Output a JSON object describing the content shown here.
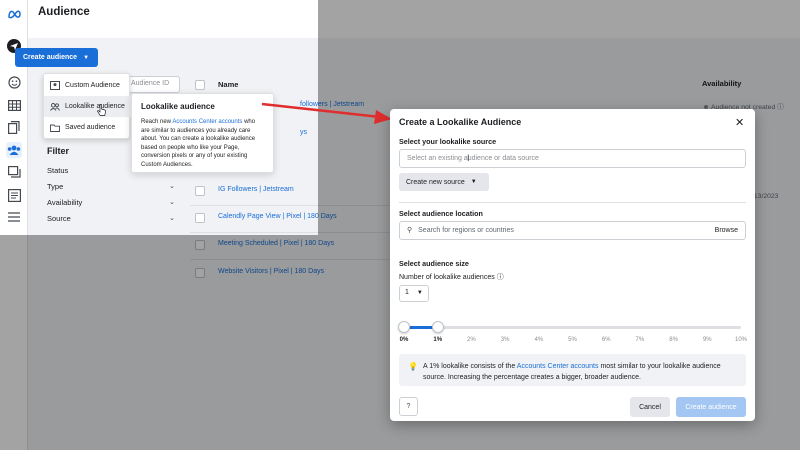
{
  "page": {
    "title": "Audience"
  },
  "toolbar": {
    "create_label": "Create audience",
    "audience_id_placeholder": "Audience ID"
  },
  "create_menu": {
    "items": [
      {
        "label": "Custom Audience",
        "icon": "people-icon"
      },
      {
        "label": "Lookalike audience",
        "icon": "people-outline-icon"
      },
      {
        "label": "Saved audience",
        "icon": "folder-icon"
      }
    ]
  },
  "tooltip": {
    "title": "Lookalike audience",
    "body_pre": "Reach new ",
    "body_link": "Accounts Center accounts",
    "body_post": " who are similar to audiences you already care about. You can create a lookalike audience based on people who like your Page, conversion pixels or any of your existing Custom Audiences."
  },
  "filter": {
    "title": "Filter",
    "items": [
      "Status",
      "Type",
      "Availability",
      "Source"
    ]
  },
  "table": {
    "name_header": "Name",
    "availability_header": "Availability",
    "rows": [
      {
        "name": "followers | Jetstream"
      },
      {
        "name": "ys"
      },
      {
        "name": "IG Followers | Jetstream"
      },
      {
        "name": "Calendly Page View | Pixel | 180 Days"
      },
      {
        "name": "Meeting Scheduled | Pixel | 180 Days"
      },
      {
        "name": "Website Visitors | Pixel | 180 Days"
      }
    ],
    "availability_status": "Audience not created",
    "date_fragment": "/13/2023"
  },
  "modal": {
    "title": "Create a Lookalike Audience",
    "source_label": "Select your lookalike source",
    "source_placeholder": "Select an existing audience or data source",
    "create_source_label": "Create new source",
    "location_label": "Select audience location",
    "location_placeholder": "Search for regions or countries",
    "browse_label": "Browse",
    "size_label": "Select audience size",
    "number_label": "Number of lookalike audiences",
    "number_value": "1",
    "slider": {
      "ticks": [
        "0%",
        "1%",
        "2%",
        "3%",
        "4%",
        "5%",
        "6%",
        "7%",
        "8%",
        "9%",
        "10%"
      ],
      "range_start": 0,
      "range_end": 1,
      "max": 10
    },
    "info_pre": "A 1% lookalike consists of the ",
    "info_link": "Accounts Center accounts",
    "info_post": " most similar to your lookalike audience source. Increasing the percentage creates a bigger, broader audience.",
    "cancel_label": "Cancel",
    "create_label": "Create audience"
  },
  "colors": {
    "accent": "#1a6ed8",
    "arrow": "#e02e2e",
    "disabled": "#a3c6f2"
  }
}
